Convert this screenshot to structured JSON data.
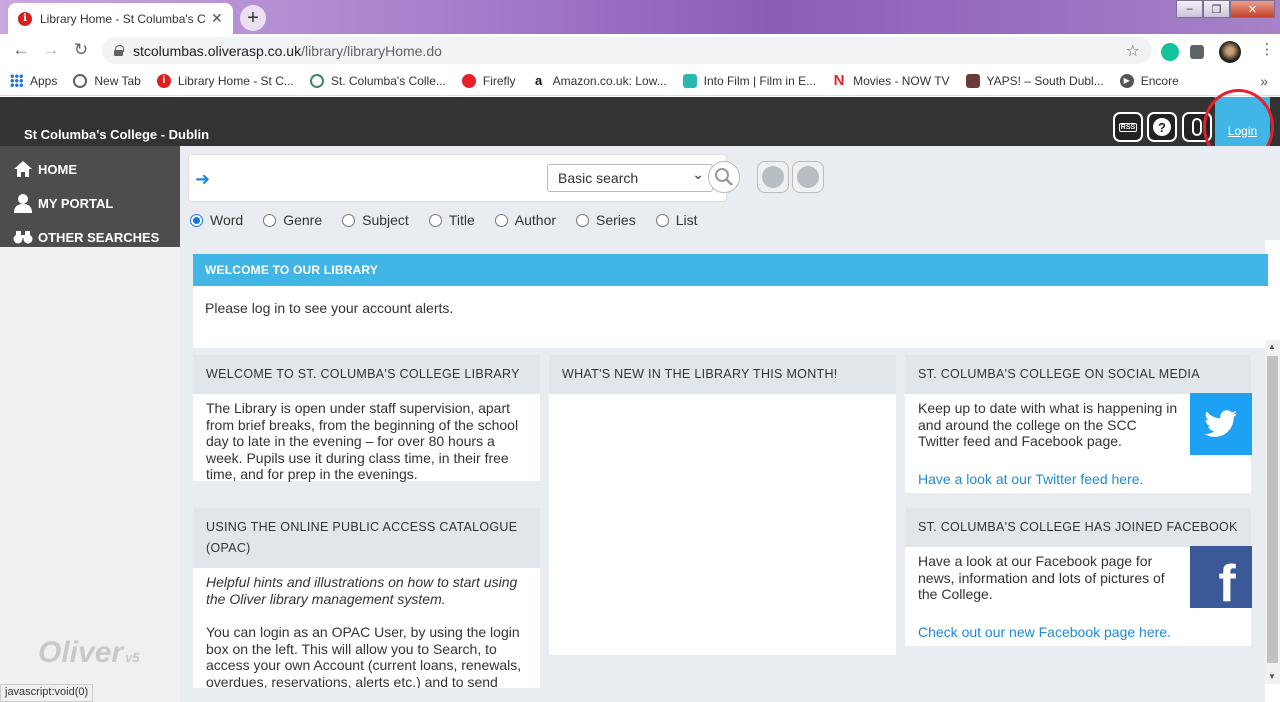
{
  "browser": {
    "tab_title": "Library Home - St Columba's Coll",
    "tab_close": "✕",
    "new_tab": "+",
    "url_host": "stcolumbas.oliverasp.co.uk",
    "url_path": "/library/libraryHome.do",
    "bookmarks": [
      {
        "label": "Apps",
        "icon": "apps-icon"
      },
      {
        "label": "New Tab",
        "icon": "globe-icon"
      },
      {
        "label": "Library Home - St C...",
        "icon": "oliver-icon"
      },
      {
        "label": "St. Columba's Colle...",
        "icon": "college-icon"
      },
      {
        "label": "Firefly",
        "icon": "firefly-icon"
      },
      {
        "label": "Amazon.co.uk: Low...",
        "icon": "amazon-icon"
      },
      {
        "label": "Into Film | Film in E...",
        "icon": "intofilm-icon"
      },
      {
        "label": "Movies - NOW TV",
        "icon": "nowtv-icon"
      },
      {
        "label": "YAPS! – South Dubl...",
        "icon": "yaps-icon"
      },
      {
        "label": "Encore",
        "icon": "encore-icon"
      }
    ],
    "more": "»",
    "status_text": "javascript:void(0)"
  },
  "header": {
    "site_name": "St Columba's College - Dublin",
    "rss_label": "RSS",
    "help_label": "?",
    "login_label": "Login"
  },
  "sidebar": {
    "items": [
      {
        "label": "HOME",
        "icon": "home-icon"
      },
      {
        "label": "MY PORTAL",
        "icon": "person-icon"
      },
      {
        "label": "OTHER SEARCHES",
        "icon": "binoculars-icon"
      }
    ],
    "logo_text": "Oliver",
    "logo_suffix": "v5"
  },
  "search": {
    "mode_selected": "Basic search",
    "options": [
      {
        "label": "Word",
        "checked": true
      },
      {
        "label": "Genre",
        "checked": false
      },
      {
        "label": "Subject",
        "checked": false
      },
      {
        "label": "Title",
        "checked": false
      },
      {
        "label": "Author",
        "checked": false
      },
      {
        "label": "Series",
        "checked": false
      },
      {
        "label": "List",
        "checked": false
      }
    ]
  },
  "main": {
    "welcome_title": "WELCOME TO OUR LIBRARY",
    "alerts_text": "Please log in to see your account alerts.",
    "panels": {
      "library": {
        "title": "WELCOME TO ST. COLUMBA'S COLLEGE LIBRARY",
        "body": "The Library is open under staff supervision, apart from brief breaks, from the beginning of the school day to late in the evening – for over 80 hours a week. Pupils use it during class time, in their free time, and for prep in the evenings."
      },
      "whatsnew": {
        "title": "WHAT'S NEW IN THE LIBRARY THIS MONTH!"
      },
      "social": {
        "title": "ST. COLUMBA'S COLLEGE ON SOCIAL MEDIA",
        "body": "Keep up to date with what is happening in and around the college on the SCC Twitter feed and Facebook page.",
        "link": "Have a look at our Twitter feed here."
      },
      "opac": {
        "title": "USING THE ONLINE PUBLIC ACCESS CATALOGUE (OPAC)",
        "intro": "Helpful hints and illustrations on how to start using the Oliver library management system.",
        "body": "You can login as an OPAC User, by using the login box on the left. This will allow you to Search, to access your own Account (current loans, renewals, overdues, reservations, alerts etc.) and to send Requests and Reviews."
      },
      "facebook": {
        "title": "ST. COLUMBA'S COLLEGE HAS JOINED FACEBOOK",
        "body": "Have a look at our Facebook page for news, information and lots of pictures of the College.",
        "link": "Check out our new Facebook page here."
      }
    }
  },
  "colors": {
    "accent_blue": "#41b6e6",
    "header_dark": "#333333",
    "sidebar_dark": "#4d4d4d",
    "link_blue": "#1f8ad6",
    "twitter_blue": "#1da1f2",
    "facebook_blue": "#3b5998",
    "annotation_red": "#e8202a"
  }
}
